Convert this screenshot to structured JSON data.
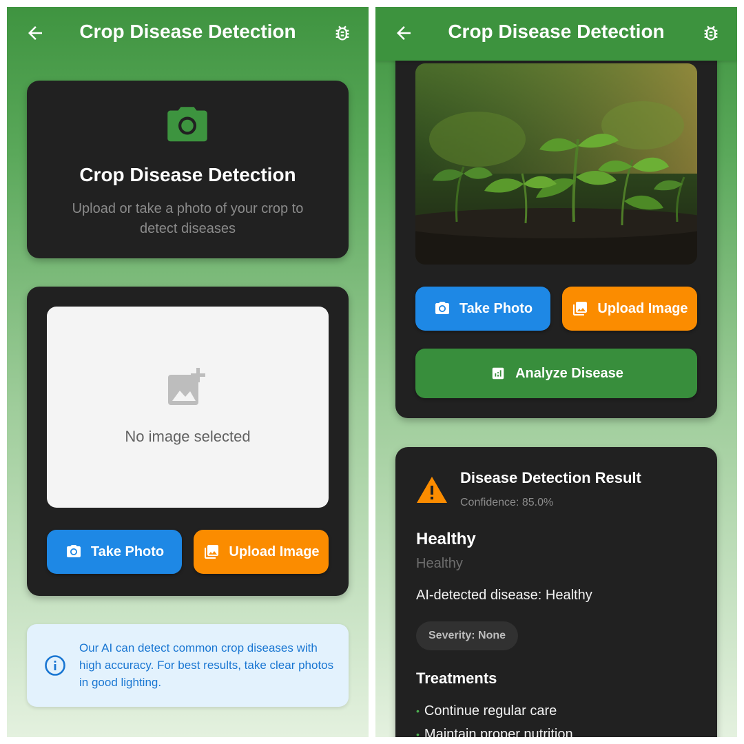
{
  "app": {
    "title": "Crop Disease Detection"
  },
  "icons": {
    "back": "arrow-back-icon",
    "debug": "bug-icon",
    "header": "camera-icon",
    "placeholder": "add-photo-icon",
    "info": "info-icon",
    "warning": "warning-icon",
    "analyze": "analytics-icon"
  },
  "colors": {
    "app_bar": "#3d933e",
    "card": "#212121",
    "take_photo": "#1e88e5",
    "upload_image": "#fb8c00",
    "analyze": "#388e3c",
    "info_bg": "#e3f2fd",
    "info_text": "#1976d2",
    "warning": "#fb8c00"
  },
  "left_screen": {
    "header_card": {
      "title": "Crop Disease Detection",
      "subtitle": "Upload or take a photo of your crop to detect diseases"
    },
    "picker": {
      "placeholder_text": "No image selected",
      "take_photo_label": "Take Photo",
      "upload_image_label": "Upload Image"
    },
    "info": {
      "text": "Our AI can detect common crop diseases with high accuracy. For best results, take clear photos in good lighting."
    }
  },
  "right_screen": {
    "preview": {
      "take_photo_label": "Take Photo",
      "upload_image_label": "Upload Image",
      "analyze_label": "Analyze Disease"
    },
    "result": {
      "title": "Disease Detection Result",
      "confidence": "Confidence: 85.0%",
      "disease_name": "Healthy",
      "disease_subtitle": "Healthy",
      "description": "AI-detected disease: Healthy",
      "severity": "Severity: None",
      "treatments_title": "Treatments",
      "treatments": [
        "Continue regular care",
        "Maintain proper nutrition"
      ]
    }
  }
}
